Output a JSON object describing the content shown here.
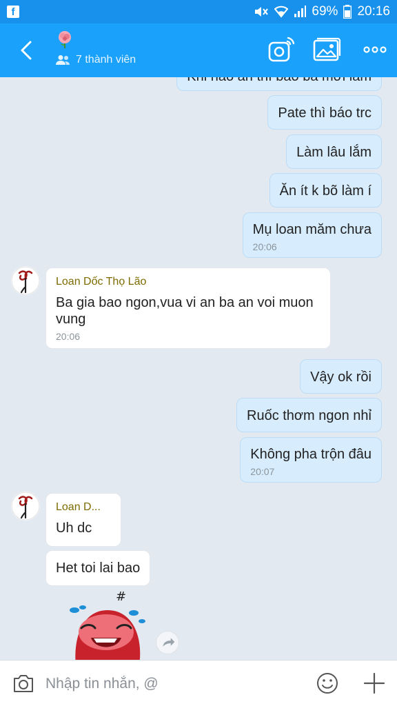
{
  "status_bar": {
    "app_icon": "f",
    "battery": "69%",
    "time": "20:16",
    "icons": [
      "mute-icon",
      "wifi-icon",
      "signal-icon",
      "battery-icon"
    ]
  },
  "header": {
    "member_count": "7 thành viên",
    "icons": [
      "back-icon",
      "rose-icon",
      "people-icon",
      "camera-signal-icon",
      "gallery-icon",
      "more-icon"
    ]
  },
  "messages": {
    "m0": {
      "text": "Khi nào ăn thì báo bà mới làm"
    },
    "m1": {
      "text": "Pate thì báo trc"
    },
    "m2": {
      "text": "Làm lâu lắm"
    },
    "m3": {
      "text": "Ăn ít k bõ làm í"
    },
    "m4": {
      "text": "Mụ loan măm chưa",
      "time": "20:06"
    },
    "m5": {
      "sender": "Loan Dốc Thọ Lão",
      "text": "Ba gia bao ngon,vua vi an ba an voi muon vung",
      "time": "20:06"
    },
    "m6": {
      "text": "Vậy ok rồi"
    },
    "m7": {
      "text": "Ruốc thơm ngon nhỉ"
    },
    "m8": {
      "text": "Không pha trộn đâu",
      "time": "20:07"
    },
    "m9": {
      "sender": "Loan D...",
      "text": "Uh dc"
    },
    "m10": {
      "text": "Het toi lai bao"
    }
  },
  "composer": {
    "placeholder": "Nhập tin nhắn, @"
  },
  "colors": {
    "header": "#1aa1fb",
    "status_bar": "#1891ec",
    "chat_background": "#e2e9f1",
    "outgoing_bubble": "#d7ecfd",
    "incoming_bubble": "#ffffff",
    "sender_name": "#7d6a00"
  }
}
